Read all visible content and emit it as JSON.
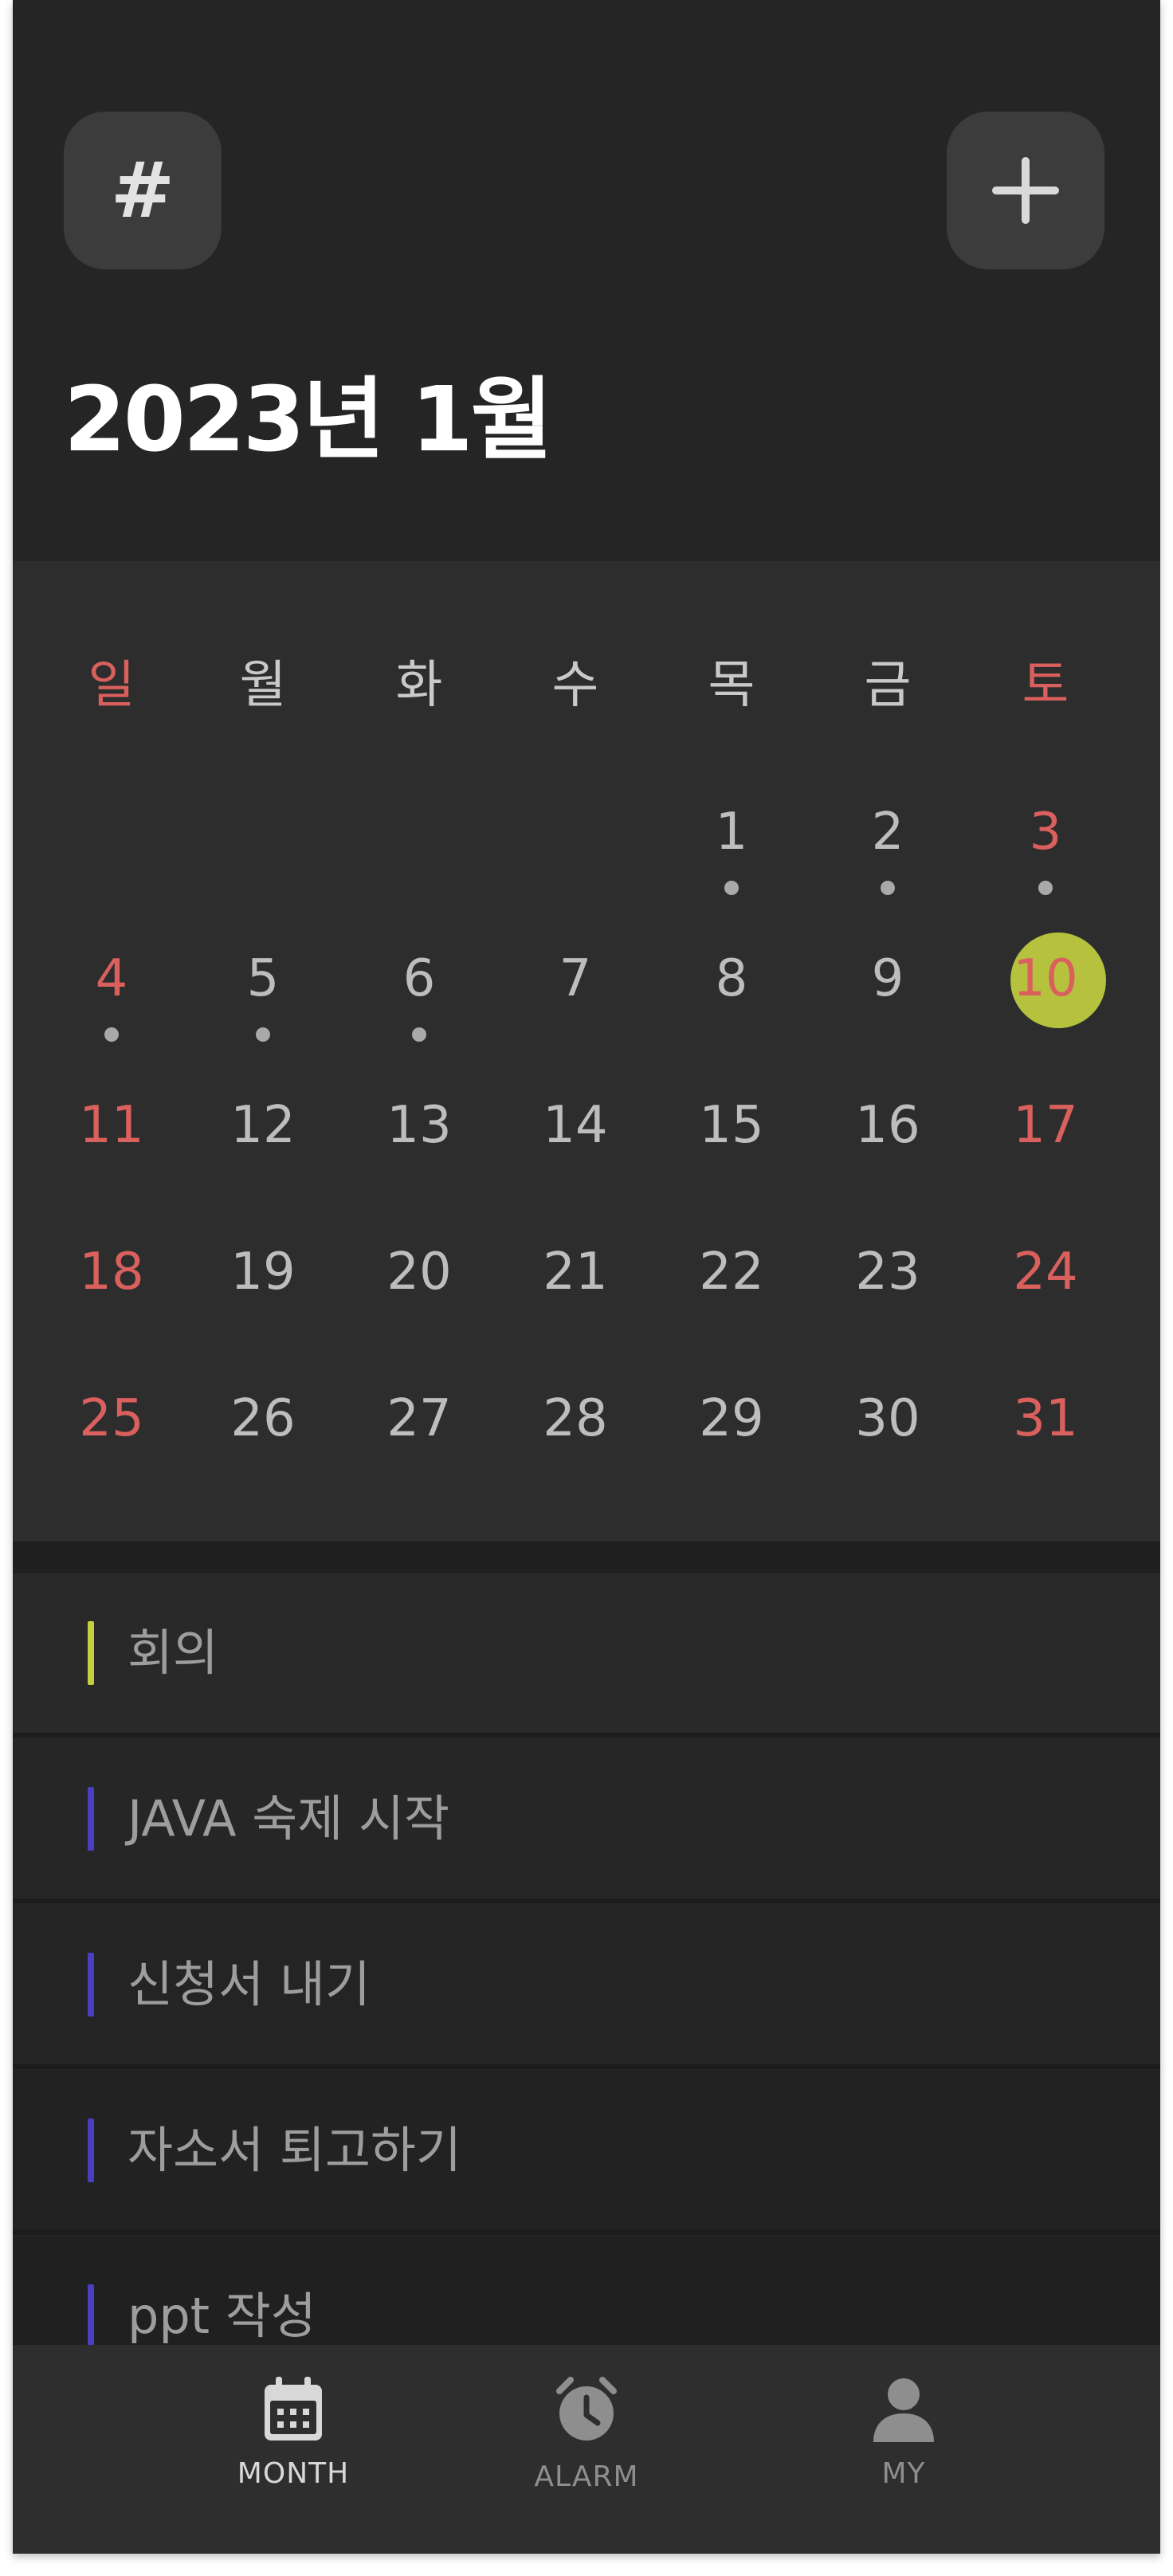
{
  "header": {
    "tag_button_label": "#",
    "month_title": "2023년 1월"
  },
  "calendar": {
    "weekdays": [
      "일",
      "월",
      "화",
      "수",
      "목",
      "금",
      "토"
    ],
    "weeks": [
      [
        "",
        "",
        "",
        "",
        "1",
        "2",
        "3"
      ],
      [
        "4",
        "5",
        "6",
        "7",
        "8",
        "9",
        "10"
      ],
      [
        "11",
        "12",
        "13",
        "14",
        "15",
        "16",
        "17"
      ],
      [
        "18",
        "19",
        "20",
        "21",
        "22",
        "23",
        "24"
      ],
      [
        "25",
        "26",
        "27",
        "28",
        "29",
        "30",
        "31"
      ]
    ],
    "days_with_events": [
      "1",
      "2",
      "3",
      "4",
      "5",
      "6"
    ],
    "selected_day": "10"
  },
  "events": [
    {
      "title": "회의",
      "color": "#c5cf3e"
    },
    {
      "title": "JAVA 숙제 시작",
      "color": "#4a3fc4"
    },
    {
      "title": "신청서 내기",
      "color": "#4a3fc4"
    },
    {
      "title": "자소서 퇴고하기",
      "color": "#4a3fc4"
    },
    {
      "title": "ppt 작성",
      "color": "#4a3fc4"
    }
  ],
  "bottom_nav": {
    "items": [
      {
        "label": "MONTH",
        "icon": "calendar-icon",
        "active": true
      },
      {
        "label": "ALARM",
        "icon": "alarm-clock-icon",
        "active": false
      },
      {
        "label": "MY",
        "icon": "user-icon",
        "active": false
      }
    ]
  },
  "colors": {
    "background": "#252525",
    "calendar_background": "#2d2d2d",
    "weekend": "#d9605d",
    "weekday_text": "#bdbdbd",
    "today_highlight": "#b6c23d",
    "nav_active": "#d8d8d8",
    "nav_inactive": "#8e8e8e"
  }
}
